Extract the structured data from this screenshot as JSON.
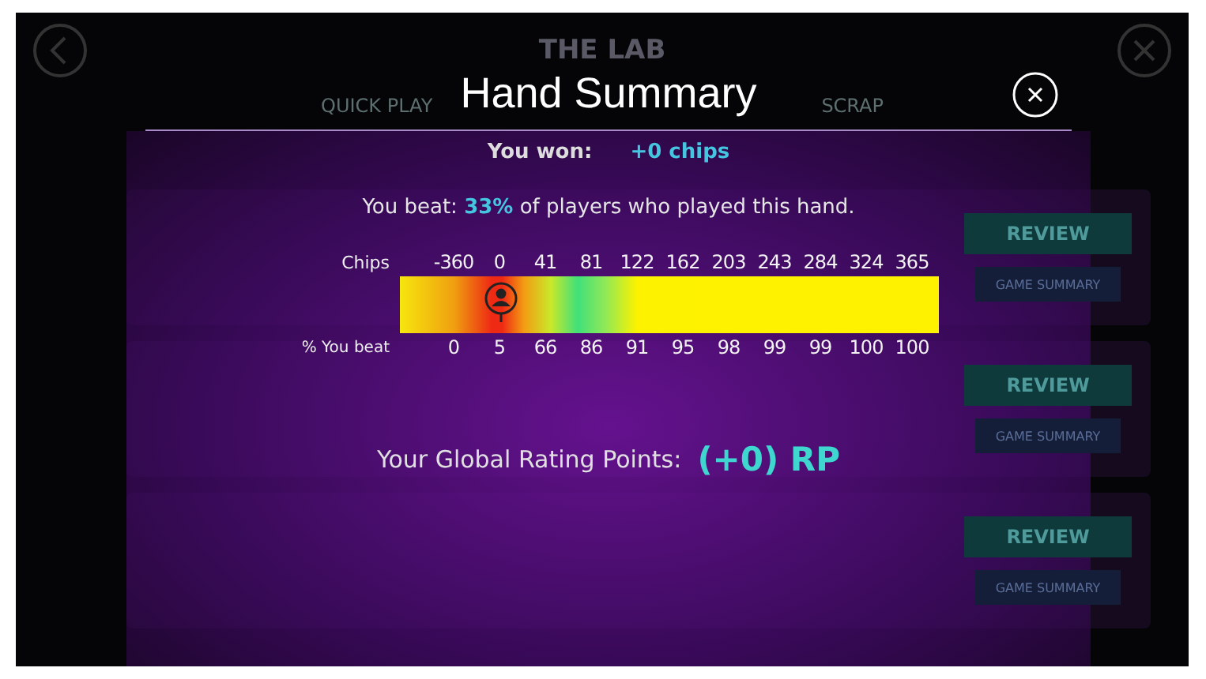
{
  "app_header": {
    "title": "THE LAB",
    "tabs": [
      {
        "label": "QUICK PLAY",
        "selected": false
      },
      {
        "label": "SCRAP",
        "selected": false
      }
    ]
  },
  "background_rows": [
    {
      "buttons": [
        "REVIEW",
        "GAME SUMMARY"
      ]
    },
    {
      "buttons": [
        "REVIEW",
        "GAME SUMMARY"
      ]
    },
    {
      "buttons": [
        "REVIEW",
        "GAME SUMMARY"
      ]
    }
  ],
  "dialog": {
    "title": "Hand Summary",
    "won_label": "You won:",
    "won_value": "+0 chips",
    "beat_text": "You beat: **33%** of players who played this hand.",
    "chips_label": "Chips",
    "chips_ticks": [
      "-360",
      "0",
      "41",
      "81",
      "122",
      "162",
      "203",
      "243",
      "284",
      "324",
      "365"
    ],
    "marker": {
      "level": 0.19
    },
    "beat_label": "% You beat",
    "beat_ticks": [
      "0",
      "5",
      "66",
      "86",
      "91",
      "95",
      "98",
      "99",
      "99",
      "100",
      "100"
    ],
    "rating_label": "Your Global Rating Points:",
    "rating_value": "(+0) RP"
  }
}
